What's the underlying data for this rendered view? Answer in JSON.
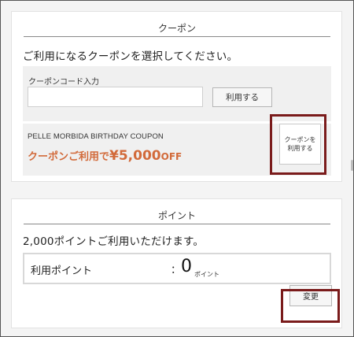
{
  "coupon_section": {
    "title": "クーポン",
    "intro": "ご利用になるクーポンを選択してください。",
    "code_label": "クーポンコード入力",
    "code_value": "",
    "code_placeholder": "",
    "use_button": "利用する",
    "coupon": {
      "name": "PELLE MORBIDA BIRTHDAY COUPON",
      "offer_prefix": "クーポンご利用で",
      "offer_amount": "¥5,000",
      "offer_suffix": "OFF"
    },
    "apply_button": "クーポンを\n利用する"
  },
  "points_section": {
    "title": "ポイント",
    "available": "2,000ポイントご利用いただけます。",
    "label": "利用ポイント",
    "separator": "：",
    "value": "0",
    "unit": "ポイント",
    "change_button": "変更"
  },
  "colors": {
    "accent_offer": "#d26a3a",
    "highlight_border": "#7a1b1b",
    "panel_gray": "#f0f0f0"
  }
}
